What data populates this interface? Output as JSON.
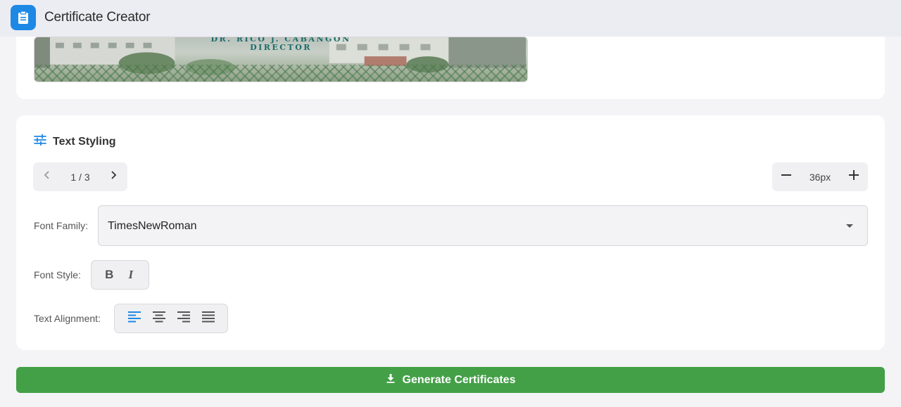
{
  "app": {
    "title": "Certificate Creator",
    "icon": "clipboard-icon",
    "accent": "#1e88e5"
  },
  "preview": {
    "name_line": "DR. RICO J. CABANGON",
    "title_line": "DIRECTOR"
  },
  "styling": {
    "section_title": "Text Styling",
    "section_icon": "sliders-icon",
    "pager": {
      "current": "1 / 3"
    },
    "font_size": "36px",
    "font_family_label": "Font Family:",
    "font_family_value": "TimesNewRoman",
    "font_style_label": "Font Style:",
    "bold_label": "B",
    "italic_label": "I",
    "alignment_label": "Text Alignment:",
    "alignment_selected": "left"
  },
  "actions": {
    "generate_label": "Generate Certificates",
    "generate_color": "#43a047"
  }
}
